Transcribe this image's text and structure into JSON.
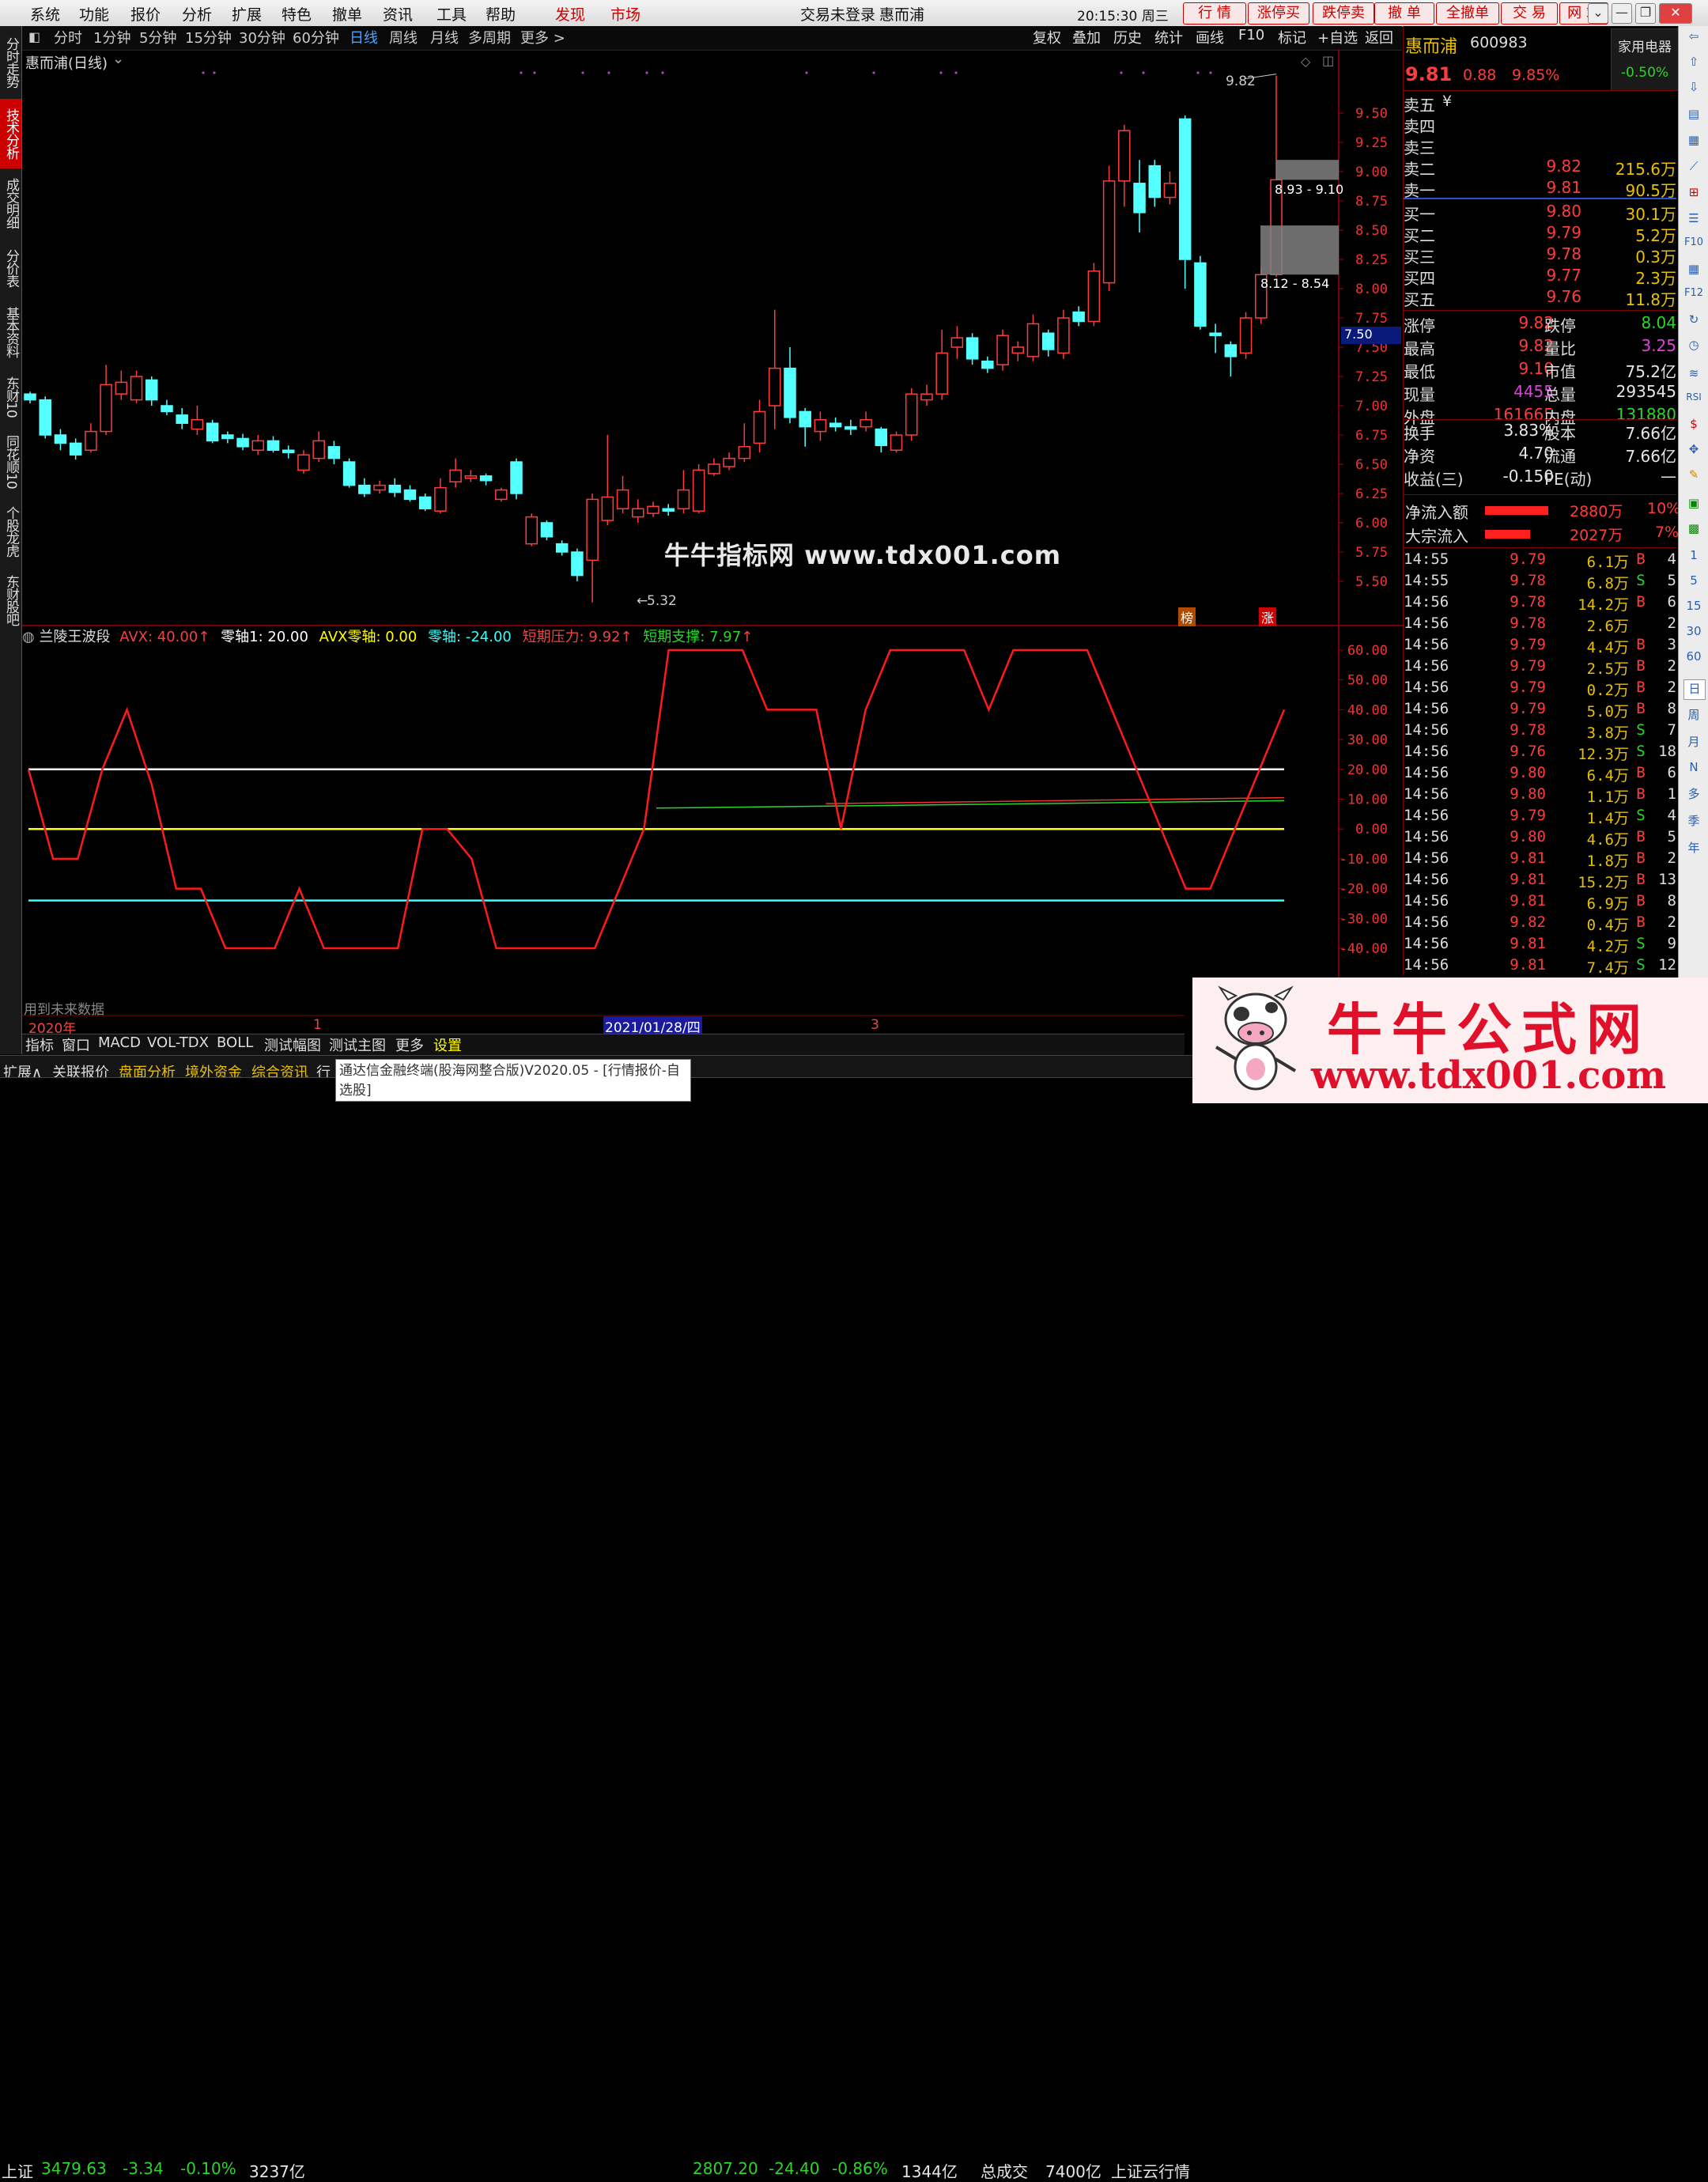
{
  "menu": {
    "items": [
      "系统",
      "功能",
      "报价",
      "分析",
      "扩展",
      "特色",
      "撤单",
      "资讯",
      "工具",
      "帮助"
    ],
    "discover": "发现",
    "market": "市场",
    "login_status": "交易未登录",
    "stock_title": "惠而浦",
    "clock": "20:15:30 周三",
    "quick_buttons": [
      "行 情",
      "涨停买",
      "跌停卖",
      "撤 单",
      "全撤单",
      "交 易",
      "网 站"
    ]
  },
  "left_tabs": [
    "分时走势",
    "技术分析",
    "成交明细",
    "分价表",
    "基本资料",
    "东财10",
    "同花顺10",
    "个股龙虎",
    "东财股吧"
  ],
  "periods": [
    "分时",
    "1分钟",
    "5分钟",
    "15分钟",
    "30分钟",
    "60分钟",
    "日线",
    "周线",
    "月线",
    "多周期",
    "更多 >"
  ],
  "chart_tools": [
    "复权",
    "叠加",
    "历史",
    "统计",
    "画线",
    "F10",
    "标记",
    "+自选",
    "返回"
  ],
  "chart": {
    "title": "惠而浦(日线)",
    "high_marker": "9.82",
    "low_marker": "5.32",
    "box_top_label": "8.93 - 9.10",
    "box_bottom_label": "8.12 - 8.54",
    "current_price_tag": "7.50",
    "watermark": "牛牛指标网 www.tdx001.com",
    "tag_bang": "榜",
    "tag_zhang": "涨"
  },
  "indicator": {
    "name": "兰陵王波段",
    "avx": "AVX: 40.00",
    "zero1": "零轴1: 20.00",
    "avx_zero": "AVX零轴: 0.00",
    "zero": "零轴: -24.00",
    "press": "短期压力: 9.92",
    "support": "短期支撑: 7.97",
    "future_note": "用到未来数据"
  },
  "time_axis": {
    "year": "2020年",
    "m1": "1",
    "cursor_date": "2021/01/28/四",
    "m3": "3"
  },
  "price_axis": [
    "9.50",
    "9.25",
    "9.00",
    "8.75",
    "8.50",
    "8.25",
    "8.00",
    "7.75",
    "7.50",
    "7.25",
    "7.00",
    "6.75",
    "6.50",
    "6.25",
    "6.00",
    "5.75",
    "5.50"
  ],
  "ind_axis": [
    "60.00",
    "50.00",
    "40.00",
    "30.00",
    "20.00",
    "10.00",
    "0.00",
    "-10.00",
    "-20.00",
    "-30.00",
    "-40.00"
  ],
  "chart_data": {
    "type": "candlestick",
    "title": "惠而浦(日线)",
    "ylim": [
      5.3,
      9.85
    ],
    "candles": [
      {
        "o": 7.1,
        "c": 7.05,
        "h": 7.12,
        "l": 7.02
      },
      {
        "o": 7.05,
        "c": 6.75,
        "h": 7.08,
        "l": 6.72
      },
      {
        "o": 6.75,
        "c": 6.68,
        "h": 6.8,
        "l": 6.62
      },
      {
        "o": 6.68,
        "c": 6.58,
        "h": 6.72,
        "l": 6.54
      },
      {
        "o": 6.62,
        "c": 6.78,
        "h": 6.85,
        "l": 6.6
      },
      {
        "o": 6.78,
        "c": 7.18,
        "h": 7.35,
        "l": 6.75
      },
      {
        "o": 7.1,
        "c": 7.2,
        "h": 7.3,
        "l": 7.05
      },
      {
        "o": 7.05,
        "c": 7.25,
        "h": 7.3,
        "l": 7.02
      },
      {
        "o": 7.22,
        "c": 7.05,
        "h": 7.25,
        "l": 7.0
      },
      {
        "o": 7.0,
        "c": 6.95,
        "h": 7.05,
        "l": 6.92
      },
      {
        "o": 6.92,
        "c": 6.85,
        "h": 6.98,
        "l": 6.8
      },
      {
        "o": 6.8,
        "c": 6.88,
        "h": 7.0,
        "l": 6.75
      },
      {
        "o": 6.85,
        "c": 6.7,
        "h": 6.88,
        "l": 6.68
      },
      {
        "o": 6.75,
        "c": 6.72,
        "h": 6.78,
        "l": 6.68
      },
      {
        "o": 6.72,
        "c": 6.65,
        "h": 6.76,
        "l": 6.62
      },
      {
        "o": 6.62,
        "c": 6.7,
        "h": 6.75,
        "l": 6.58
      },
      {
        "o": 6.7,
        "c": 6.62,
        "h": 6.74,
        "l": 6.6
      },
      {
        "o": 6.62,
        "c": 6.6,
        "h": 6.66,
        "l": 6.55
      },
      {
        "o": 6.45,
        "c": 6.58,
        "h": 6.62,
        "l": 6.42
      },
      {
        "o": 6.55,
        "c": 6.7,
        "h": 6.78,
        "l": 6.52
      },
      {
        "o": 6.65,
        "c": 6.55,
        "h": 6.7,
        "l": 6.5
      },
      {
        "o": 6.52,
        "c": 6.32,
        "h": 6.55,
        "l": 6.3
      },
      {
        "o": 6.32,
        "c": 6.25,
        "h": 6.38,
        "l": 6.22
      },
      {
        "o": 6.28,
        "c": 6.32,
        "h": 6.36,
        "l": 6.25
      },
      {
        "o": 6.32,
        "c": 6.26,
        "h": 6.38,
        "l": 6.22
      },
      {
        "o": 6.28,
        "c": 6.2,
        "h": 6.32,
        "l": 6.18
      },
      {
        "o": 6.22,
        "c": 6.12,
        "h": 6.25,
        "l": 6.1
      },
      {
        "o": 6.1,
        "c": 6.3,
        "h": 6.38,
        "l": 6.08
      },
      {
        "o": 6.35,
        "c": 6.45,
        "h": 6.55,
        "l": 6.3
      },
      {
        "o": 6.38,
        "c": 6.4,
        "h": 6.45,
        "l": 6.35
      },
      {
        "o": 6.4,
        "c": 6.36,
        "h": 6.42,
        "l": 6.32
      },
      {
        "o": 6.2,
        "c": 6.28,
        "h": 6.3,
        "l": 6.18
      },
      {
        "o": 6.52,
        "c": 6.25,
        "h": 6.55,
        "l": 6.2
      },
      {
        "o": 5.82,
        "c": 6.05,
        "h": 6.08,
        "l": 5.8
      },
      {
        "o": 6.0,
        "c": 5.88,
        "h": 6.02,
        "l": 5.85
      },
      {
        "o": 5.82,
        "c": 5.75,
        "h": 5.85,
        "l": 5.72
      },
      {
        "o": 5.75,
        "c": 5.55,
        "h": 5.78,
        "l": 5.5
      },
      {
        "o": 5.68,
        "c": 6.2,
        "h": 6.25,
        "l": 5.32
      },
      {
        "o": 6.02,
        "c": 6.22,
        "h": 6.75,
        "l": 5.98
      },
      {
        "o": 6.12,
        "c": 6.28,
        "h": 6.4,
        "l": 6.08
      },
      {
        "o": 6.05,
        "c": 6.12,
        "h": 6.2,
        "l": 6.0
      },
      {
        "o": 6.08,
        "c": 6.14,
        "h": 6.18,
        "l": 6.05
      },
      {
        "o": 6.12,
        "c": 6.1,
        "h": 6.16,
        "l": 6.06
      },
      {
        "o": 6.12,
        "c": 6.28,
        "h": 6.45,
        "l": 6.08
      },
      {
        "o": 6.1,
        "c": 6.45,
        "h": 6.5,
        "l": 6.08
      },
      {
        "o": 6.42,
        "c": 6.5,
        "h": 6.55,
        "l": 6.4
      },
      {
        "o": 6.48,
        "c": 6.55,
        "h": 6.6,
        "l": 6.45
      },
      {
        "o": 6.55,
        "c": 6.65,
        "h": 6.85,
        "l": 6.52
      },
      {
        "o": 6.68,
        "c": 6.95,
        "h": 7.05,
        "l": 6.6
      },
      {
        "o": 7.0,
        "c": 7.32,
        "h": 7.82,
        "l": 6.8
      },
      {
        "o": 7.32,
        "c": 6.9,
        "h": 7.5,
        "l": 6.85
      },
      {
        "o": 6.95,
        "c": 6.82,
        "h": 6.98,
        "l": 6.65
      },
      {
        "o": 6.78,
        "c": 6.88,
        "h": 6.95,
        "l": 6.7
      },
      {
        "o": 6.85,
        "c": 6.82,
        "h": 6.9,
        "l": 6.78
      },
      {
        "o": 6.82,
        "c": 6.8,
        "h": 6.88,
        "l": 6.75
      },
      {
        "o": 6.82,
        "c": 6.88,
        "h": 6.95,
        "l": 6.78
      },
      {
        "o": 6.8,
        "c": 6.66,
        "h": 6.82,
        "l": 6.6
      },
      {
        "o": 6.62,
        "c": 6.75,
        "h": 6.78,
        "l": 6.6
      },
      {
        "o": 6.75,
        "c": 7.1,
        "h": 7.15,
        "l": 6.7
      },
      {
        "o": 7.05,
        "c": 7.1,
        "h": 7.18,
        "l": 7.0
      },
      {
        "o": 7.1,
        "c": 7.45,
        "h": 7.65,
        "l": 7.05
      },
      {
        "o": 7.5,
        "c": 7.58,
        "h": 7.68,
        "l": 7.4
      },
      {
        "o": 7.58,
        "c": 7.4,
        "h": 7.62,
        "l": 7.35
      },
      {
        "o": 7.38,
        "c": 7.32,
        "h": 7.42,
        "l": 7.28
      },
      {
        "o": 7.35,
        "c": 7.6,
        "h": 7.65,
        "l": 7.3
      },
      {
        "o": 7.45,
        "c": 7.5,
        "h": 7.55,
        "l": 7.38
      },
      {
        "o": 7.42,
        "c": 7.7,
        "h": 7.78,
        "l": 7.38
      },
      {
        "o": 7.62,
        "c": 7.48,
        "h": 7.65,
        "l": 7.42
      },
      {
        "o": 7.45,
        "c": 7.75,
        "h": 7.82,
        "l": 7.4
      },
      {
        "o": 7.8,
        "c": 7.72,
        "h": 7.85,
        "l": 7.68
      },
      {
        "o": 7.72,
        "c": 8.15,
        "h": 8.22,
        "l": 7.68
      },
      {
        "o": 8.05,
        "c": 8.92,
        "h": 9.05,
        "l": 7.98
      },
      {
        "o": 8.92,
        "c": 9.35,
        "h": 9.4,
        "l": 8.7
      },
      {
        "o": 8.9,
        "c": 8.65,
        "h": 9.1,
        "l": 8.48
      },
      {
        "o": 9.05,
        "c": 8.78,
        "h": 9.1,
        "l": 8.7
      },
      {
        "o": 8.78,
        "c": 8.9,
        "h": 9.0,
        "l": 8.72
      },
      {
        "o": 9.45,
        "c": 8.25,
        "h": 9.48,
        "l": 8.0
      },
      {
        "o": 8.22,
        "c": 7.68,
        "h": 8.28,
        "l": 7.65
      },
      {
        "o": 7.62,
        "c": 7.6,
        "h": 7.7,
        "l": 7.45
      },
      {
        "o": 7.52,
        "c": 7.42,
        "h": 7.55,
        "l": 7.25
      },
      {
        "o": 7.45,
        "c": 7.75,
        "h": 7.8,
        "l": 7.4
      },
      {
        "o": 7.75,
        "c": 8.12,
        "h": 8.18,
        "l": 7.7
      },
      {
        "o": 8.12,
        "c": 8.93,
        "h": 9.82,
        "l": 8.1
      }
    ]
  },
  "indicator_data": {
    "red_line": [
      20,
      -10,
      -10,
      20,
      40,
      15,
      -20,
      -20,
      -40,
      -40,
      -40,
      -20,
      -40,
      -40,
      -40,
      -40,
      0,
      0,
      -10,
      -40,
      -40,
      -40,
      -40,
      -40,
      -20,
      0,
      60,
      60,
      60,
      60,
      40,
      40,
      40,
      0,
      40,
      60,
      60,
      60,
      60,
      40,
      60,
      60,
      60,
      60,
      40,
      20,
      0,
      -20,
      -20,
      0,
      20,
      40
    ],
    "white_level": 20,
    "yellow_level": 0,
    "cyan_level": -24,
    "green_line": [
      [
        0.5,
        7
      ],
      [
        1.0,
        9.5
      ]
    ],
    "red_flat": [
      [
        0.635,
        8.5
      ],
      [
        1.0,
        10.5
      ]
    ]
  },
  "quote": {
    "name": "惠而浦",
    "code": "600983",
    "sector": "家用电器",
    "sector_change": "-0.50%",
    "price": "9.81",
    "change": "0.88",
    "change_pct": "9.85%",
    "asks": [
      {
        "label": "卖五",
        "price": "",
        "vol": ""
      },
      {
        "label": "卖四",
        "price": "",
        "vol": ""
      },
      {
        "label": "卖三",
        "price": "",
        "vol": ""
      },
      {
        "label": "卖二",
        "price": "9.82",
        "vol": "215.6万"
      },
      {
        "label": "卖一",
        "price": "9.81",
        "vol": "90.5万"
      }
    ],
    "ask5_extra": "¥",
    "bids": [
      {
        "label": "买一",
        "price": "9.80",
        "vol": "30.1万"
      },
      {
        "label": "买二",
        "price": "9.79",
        "vol": "5.2万"
      },
      {
        "label": "买三",
        "price": "9.78",
        "vol": "0.3万"
      },
      {
        "label": "买四",
        "price": "9.77",
        "vol": "2.3万"
      },
      {
        "label": "买五",
        "price": "9.76",
        "vol": "11.8万"
      }
    ],
    "stats": [
      {
        "l1": "涨停",
        "v1": "9.82",
        "l2": "跌停",
        "v2": "8.04"
      },
      {
        "l1": "最高",
        "v1": "9.82",
        "l2": "量比",
        "v2": "3.25"
      },
      {
        "l1": "最低",
        "v1": "9.10",
        "l2": "市值",
        "v2": "75.2亿"
      },
      {
        "l1": "现量",
        "v1": "4455",
        "l2": "总量",
        "v2": "293545"
      },
      {
        "l1": "外盘",
        "v1": "161665",
        "l2": "内盘",
        "v2": "131880"
      },
      {
        "l1": "换手",
        "v1": "3.83%",
        "l2": "股本",
        "v2": "7.66亿"
      },
      {
        "l1": "净资",
        "v1": "4.70",
        "l2": "流通",
        "v2": "7.66亿"
      },
      {
        "l1": "收益(三)",
        "v1": "-0.150",
        "l2": "PE(动)",
        "v2": "—"
      }
    ],
    "net_inflow_label": "净流入额",
    "net_inflow": "2880万",
    "net_inflow_pct": "10%",
    "block_inflow_label": "大宗流入",
    "block_inflow": "2027万",
    "block_inflow_pct": "7%"
  },
  "ticks": [
    {
      "t": "14:55",
      "p": "9.79",
      "v": "6.1万",
      "d": "B",
      "n": "4"
    },
    {
      "t": "14:55",
      "p": "9.78",
      "v": "6.8万",
      "d": "S",
      "n": "5"
    },
    {
      "t": "14:56",
      "p": "9.78",
      "v": "14.2万",
      "d": "B",
      "n": "6"
    },
    {
      "t": "14:56",
      "p": "9.78",
      "v": "2.6万",
      "d": "",
      "n": "2"
    },
    {
      "t": "14:56",
      "p": "9.79",
      "v": "4.4万",
      "d": "B",
      "n": "3"
    },
    {
      "t": "14:56",
      "p": "9.79",
      "v": "2.5万",
      "d": "B",
      "n": "2"
    },
    {
      "t": "14:56",
      "p": "9.79",
      "v": "0.2万",
      "d": "B",
      "n": "2"
    },
    {
      "t": "14:56",
      "p": "9.79",
      "v": "5.0万",
      "d": "B",
      "n": "8"
    },
    {
      "t": "14:56",
      "p": "9.78",
      "v": "3.8万",
      "d": "S",
      "n": "7"
    },
    {
      "t": "14:56",
      "p": "9.76",
      "v": "12.3万",
      "d": "S",
      "n": "18"
    },
    {
      "t": "14:56",
      "p": "9.80",
      "v": "6.4万",
      "d": "B",
      "n": "6"
    },
    {
      "t": "14:56",
      "p": "9.80",
      "v": "1.1万",
      "d": "B",
      "n": "1"
    },
    {
      "t": "14:56",
      "p": "9.79",
      "v": "1.4万",
      "d": "S",
      "n": "4"
    },
    {
      "t": "14:56",
      "p": "9.80",
      "v": "4.6万",
      "d": "B",
      "n": "5"
    },
    {
      "t": "14:56",
      "p": "9.81",
      "v": "1.8万",
      "d": "B",
      "n": "2"
    },
    {
      "t": "14:56",
      "p": "9.81",
      "v": "15.2万",
      "d": "B",
      "n": "13"
    },
    {
      "t": "14:56",
      "p": "9.81",
      "v": "6.9万",
      "d": "B",
      "n": "8"
    },
    {
      "t": "14:56",
      "p": "9.82",
      "v": "0.4万",
      "d": "B",
      "n": "2"
    },
    {
      "t": "14:56",
      "p": "9.81",
      "v": "4.2万",
      "d": "S",
      "n": "9"
    },
    {
      "t": "14:56",
      "p": "9.81",
      "v": "7.4万",
      "d": "S",
      "n": "12"
    }
  ],
  "bottom_tabs": [
    "指标",
    "窗口",
    "MACD",
    "VOL-TDX",
    "BOLL",
    "测试幅图",
    "测试主图",
    "更多",
    "设置"
  ],
  "bottom_links": [
    "扩展∧",
    "关联报价",
    "盘面分析",
    "境外资金",
    "综合资讯",
    "行"
  ],
  "status": {
    "sh_label": "上证",
    "sh_index": "3479.63",
    "sh_change": "-3.34",
    "sh_pct": "-0.10%",
    "sh_amount": "3237亿",
    "tooltip": "通达信金融终端(股海网整合版)V2020.05 - [行情报价-自选股]",
    "sz_index": "2807.20",
    "sz_change": "-24.40",
    "sz_pct": "-0.86%",
    "sz_amount": "1344亿",
    "total_label": "总成交",
    "total": "7400亿",
    "cloud": "上证云行情"
  },
  "ad": {
    "title": "牛牛公式网",
    "url": "www.tdx001.com"
  },
  "colors": {
    "up": "#ff3c3c",
    "down": "#54ffff",
    "grid": "#7a0000",
    "accent_red": "#c00000"
  }
}
